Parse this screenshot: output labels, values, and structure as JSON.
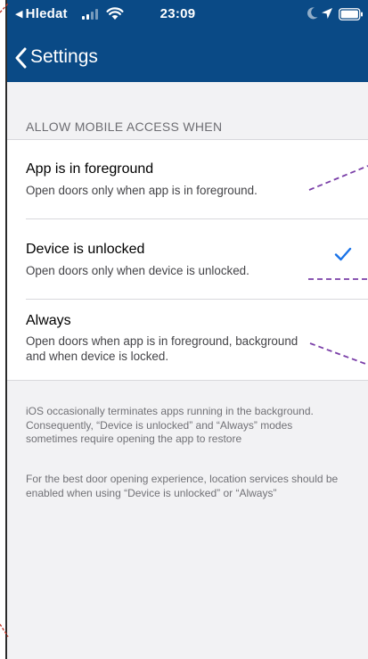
{
  "status_bar": {
    "back_app": "Hledat",
    "time": "23:09"
  },
  "nav": {
    "back_label": "Settings"
  },
  "section": {
    "header": "ALLOW MOBILE ACCESS WHEN",
    "options": [
      {
        "title": "App is in foreground",
        "subtitle": "Open doors only when app is in foreground.",
        "selected": false
      },
      {
        "title": "Device is unlocked",
        "subtitle": "Open doors only when device is unlocked.",
        "selected": true
      },
      {
        "title": "Always",
        "subtitle": "Open doors when app is in foreground, background and when device is locked.",
        "selected": false
      }
    ]
  },
  "footer": {
    "note1": "iOS occasionally terminates apps running in the background. Consequently, “Device is unlocked” and “Always” modes sometimes require opening the app to restore",
    "note2": "For the best door opening experience, location services should be enabled when using “Device is unlocked” or “Always”"
  },
  "colors": {
    "nav_background": "#0a4a86",
    "accent": "#1a73e8",
    "annotation_purple": "#7a3fa8",
    "annotation_red": "#c0392b"
  },
  "icons": {
    "carrier_back": "triangle-left-icon",
    "signal": "signal-bars-icon",
    "wifi": "wifi-icon",
    "moon": "moon-icon",
    "location": "location-arrow-icon",
    "battery": "battery-icon",
    "nav_back": "chevron-left-icon",
    "selected": "checkmark-icon"
  }
}
